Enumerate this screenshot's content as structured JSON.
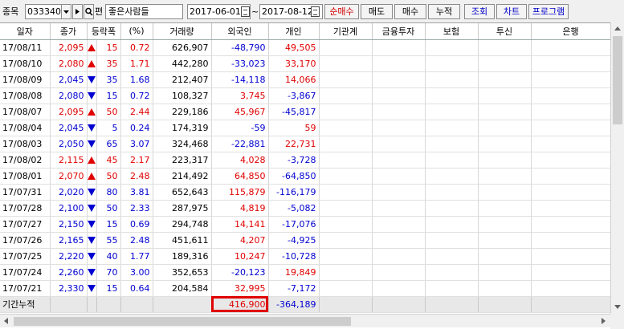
{
  "toolbar": {
    "code_label": "종목",
    "code_value": "033340",
    "search_label": "편",
    "name_value": "좋은사람들",
    "start_date": "2017-06-01",
    "range_sep": "~",
    "end_date": "2017-08-12",
    "radio_buttons": [
      "순매수",
      "매도",
      "매수",
      "누적"
    ],
    "query_label": "조회",
    "chart_label": "차트",
    "program_label": "프로그램"
  },
  "table": {
    "headers": [
      "일자",
      "종가",
      "등락폭",
      "(%)",
      "거래량",
      "외국인",
      "개인",
      "기관계",
      "금융투자",
      "보험",
      "투신",
      "은행"
    ],
    "rows": [
      {
        "date": "17/08/11",
        "close": "2,095",
        "dir": "up",
        "change": "15",
        "pct": "0.72",
        "volume": "626,907",
        "foreign": "-48,790",
        "indiv": "49,505"
      },
      {
        "date": "17/08/10",
        "close": "2,080",
        "dir": "up",
        "change": "35",
        "pct": "1.71",
        "volume": "442,280",
        "foreign": "-33,023",
        "indiv": "33,170"
      },
      {
        "date": "17/08/09",
        "close": "2,045",
        "dir": "dn",
        "change": "35",
        "pct": "1.68",
        "volume": "212,407",
        "foreign": "-14,118",
        "indiv": "14,066"
      },
      {
        "date": "17/08/08",
        "close": "2,080",
        "dir": "dn",
        "change": "15",
        "pct": "0.72",
        "volume": "108,327",
        "foreign": "3,745",
        "indiv": "-3,867"
      },
      {
        "date": "17/08/07",
        "close": "2,095",
        "dir": "up",
        "change": "50",
        "pct": "2.44",
        "volume": "229,186",
        "foreign": "45,967",
        "indiv": "-45,817"
      },
      {
        "date": "17/08/04",
        "close": "2,045",
        "dir": "dn",
        "change": "5",
        "pct": "0.24",
        "volume": "174,319",
        "foreign": "-59",
        "indiv": "59"
      },
      {
        "date": "17/08/03",
        "close": "2,050",
        "dir": "dn",
        "change": "65",
        "pct": "3.07",
        "volume": "324,468",
        "foreign": "-22,881",
        "indiv": "22,731"
      },
      {
        "date": "17/08/02",
        "close": "2,115",
        "dir": "up",
        "change": "45",
        "pct": "2.17",
        "volume": "223,317",
        "foreign": "4,028",
        "indiv": "-3,728"
      },
      {
        "date": "17/08/01",
        "close": "2,070",
        "dir": "up",
        "change": "50",
        "pct": "2.48",
        "volume": "214,492",
        "foreign": "64,850",
        "indiv": "-64,850"
      },
      {
        "date": "17/07/31",
        "close": "2,020",
        "dir": "dn",
        "change": "80",
        "pct": "3.81",
        "volume": "652,643",
        "foreign": "115,879",
        "indiv": "-116,179"
      },
      {
        "date": "17/07/28",
        "close": "2,100",
        "dir": "dn",
        "change": "50",
        "pct": "2.33",
        "volume": "287,975",
        "foreign": "4,819",
        "indiv": "-5,082"
      },
      {
        "date": "17/07/27",
        "close": "2,150",
        "dir": "dn",
        "change": "15",
        "pct": "0.69",
        "volume": "294,748",
        "foreign": "14,141",
        "indiv": "-17,076"
      },
      {
        "date": "17/07/26",
        "close": "2,165",
        "dir": "dn",
        "change": "55",
        "pct": "2.48",
        "volume": "451,611",
        "foreign": "4,207",
        "indiv": "-4,925"
      },
      {
        "date": "17/07/25",
        "close": "2,220",
        "dir": "dn",
        "change": "40",
        "pct": "1.77",
        "volume": "189,316",
        "foreign": "10,247",
        "indiv": "-10,728"
      },
      {
        "date": "17/07/24",
        "close": "2,260",
        "dir": "dn",
        "change": "70",
        "pct": "3.00",
        "volume": "352,653",
        "foreign": "-20,123",
        "indiv": "19,849"
      },
      {
        "date": "17/07/21",
        "close": "2,330",
        "dir": "dn",
        "change": "15",
        "pct": "0.64",
        "volume": "204,584",
        "foreign": "32,995",
        "indiv": "-7,172"
      }
    ],
    "summary": {
      "label": "기간누적",
      "foreign": "416,900",
      "indiv": "-364,189"
    }
  },
  "colors": {
    "up": "#e00000",
    "down": "#0000d0",
    "highlight": "#e00000"
  },
  "icons": {
    "dropdown": "dropdown-arrow-icon",
    "next": "play-icon",
    "search": "magnifier-icon",
    "calendar": "calendar-icon"
  }
}
